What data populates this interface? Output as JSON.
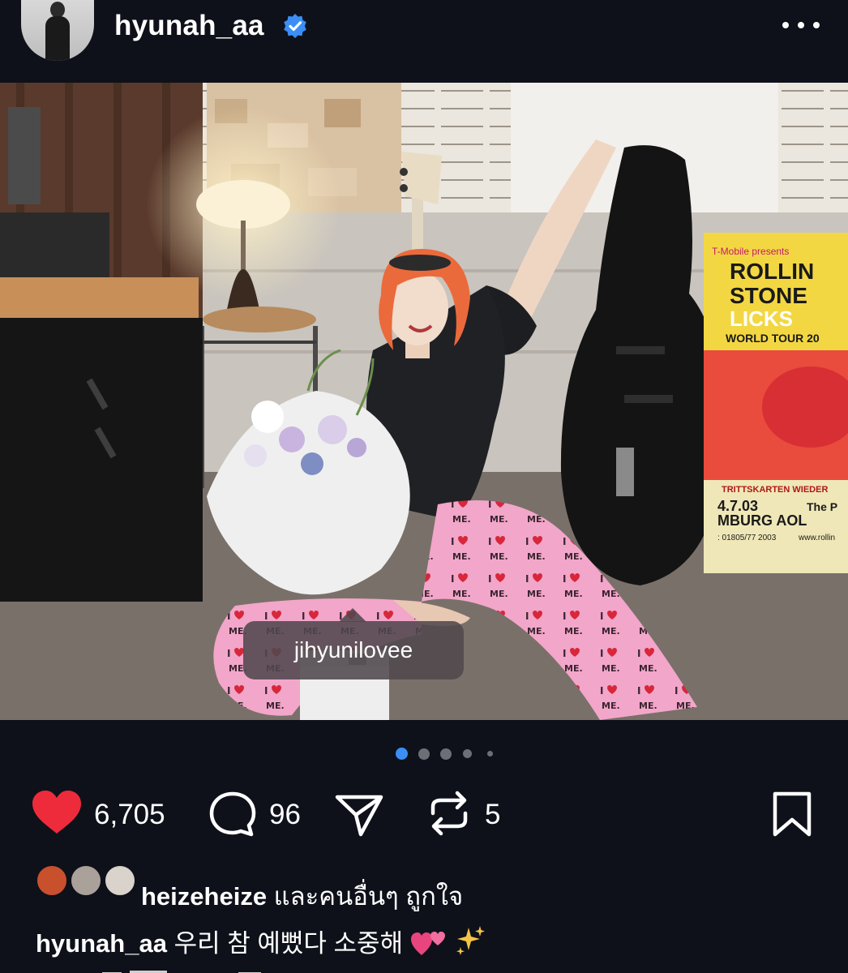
{
  "header": {
    "username": "hyunah_aa",
    "verified_icon": "verified-badge-icon",
    "more_icon": "more-horizontal-icon"
  },
  "photo": {
    "tag_label": "jihyunilovee",
    "user_tag_icon": "person-icon",
    "poster_lines": [
      "T-Mobile presents",
      "ROLLIN",
      "STONE",
      "LICKS",
      "WORLD TOUR 20",
      "TRITTSKARTEN WIEDER",
      "4.7.03",
      "The P",
      "MBURG AOL",
      ": 01805/77 2003",
      "www.rollin"
    ]
  },
  "carousel": {
    "total_dots": 5,
    "active_index": 0,
    "active_color": "#3b8ef5"
  },
  "actions": {
    "likes_count": "6,705",
    "comments_count": "96",
    "reposts_count": "5",
    "like_color": "#ed2b3b"
  },
  "liked_by": {
    "name": "heizeheize",
    "suffix": " และคนอื่นๆ ถูกใจ"
  },
  "caption": {
    "username": "hyunah_aa",
    "text": " 우리 참 예뻤다 소중해"
  }
}
